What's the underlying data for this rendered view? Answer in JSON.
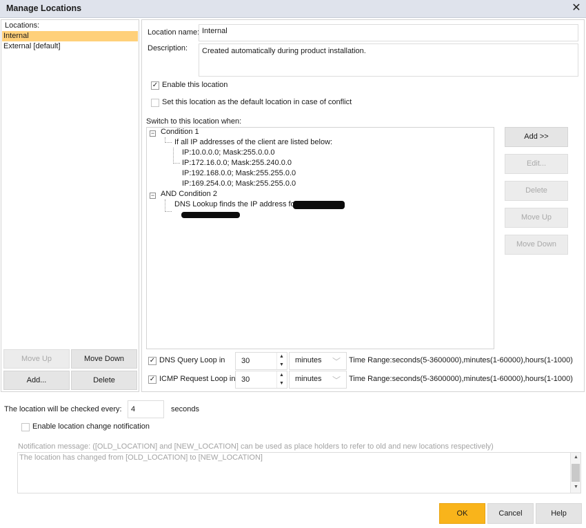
{
  "window": {
    "title": "Manage Locations",
    "close_glyph": "✕"
  },
  "left": {
    "header": "Locations:",
    "items": [
      {
        "label": "Internal",
        "selected": true
      },
      {
        "label": "External [default]",
        "selected": false
      }
    ],
    "move_up": "Move Up",
    "move_down": "Move Down",
    "add": "Add...",
    "delete": "Delete"
  },
  "details": {
    "name_label": "Location name:",
    "name_value": "Internal",
    "description_label": "Description:",
    "description_value": "Created automatically during product installation.",
    "enable_label": "Enable this location",
    "enable_checked": true,
    "default_label": "Set this location as the default location in case of conflict",
    "default_checked": false,
    "switch_label": "Switch to this location when:"
  },
  "conditions": {
    "condition1": "Condition 1",
    "condition1_desc": "If all IP addresses of the client are listed below:",
    "ips": [
      "IP:10.0.0.0; Mask:255.0.0.0",
      "IP:172.16.0.0; Mask:255.240.0.0",
      "IP:192.168.0.0; Mask:255.255.0.0",
      "IP:169.254.0.0; Mask:255.255.0.0"
    ],
    "condition2": "AND Condition 2",
    "condition2_desc": "DNS Lookup finds the IP address for",
    "toggle_glyph": "−"
  },
  "side_buttons": {
    "add": "Add >>",
    "edit": "Edit...",
    "delete": "Delete",
    "move_up": "Move Up",
    "move_down": "Move Down"
  },
  "loops": {
    "dns_label": "DNS Query Loop in",
    "dns_checked": true,
    "dns_value": "30",
    "dns_unit": "minutes",
    "icmp_label": "ICMP Request Loop in",
    "icmp_checked": true,
    "icmp_value": "30",
    "icmp_unit": "minutes",
    "range_text": "Time Range:seconds(5-3600000),minutes(1-60000),hours(1-1000)"
  },
  "bottom": {
    "check_label": "The location will be checked every:",
    "check_value": "4",
    "check_unit": "seconds",
    "notify_label": "Enable location change notification",
    "notify_checked": false,
    "message_label": "Notification message: ([OLD_LOCATION] and [NEW_LOCATION] can be used as place holders to refer to old and new locations respectively)",
    "message_value": "The location has changed from [OLD_LOCATION] to [NEW_LOCATION]"
  },
  "footer": {
    "ok": "OK",
    "cancel": "Cancel",
    "help": "Help"
  },
  "colors": {
    "selection": "#ffd07a",
    "ok_button": "#f9b41b",
    "titlebar": "#dfe3ec"
  }
}
